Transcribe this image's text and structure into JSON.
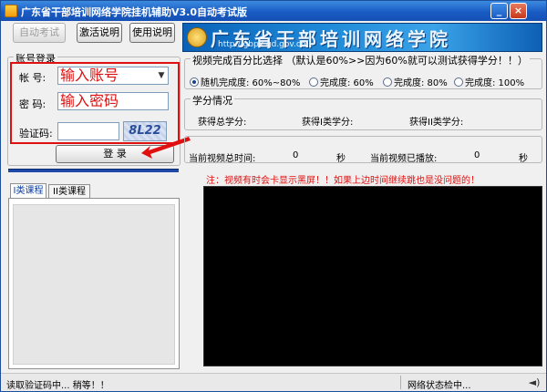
{
  "window": {
    "title": "广东省干部培训网络学院挂机辅助V3.0自动考试版",
    "minimize_glyph": "_",
    "close_glyph": "×"
  },
  "toolbar": {
    "auto_exam": "自动考试",
    "activate_help": "激活说明",
    "usage_help": "使用说明"
  },
  "banner": {
    "title": "广东省干部培训网络学院",
    "url": "http://gbpx.gd.gov.cn"
  },
  "login": {
    "group_title": "账号登录",
    "account_label": "帐  号:",
    "account_value": "输入账号",
    "password_label": "密  码:",
    "password_value": "输入密码",
    "captcha_label": "验证码:",
    "captcha_value": "",
    "captcha_image_text": "8L22",
    "login_button": "登 录"
  },
  "progress": {
    "group_title": "视频完成百分比选择 （默认是60%>>因为60%就可以测试获得学分！！）",
    "options": [
      {
        "label": "随机完成度: 60%~80%",
        "selected": true
      },
      {
        "label": "完成度: 60%",
        "selected": false
      },
      {
        "label": "完成度: 80%",
        "selected": false
      },
      {
        "label": "完成度: 100%",
        "selected": false
      }
    ]
  },
  "study": {
    "group_title": "学分情况",
    "total_credit_label": "获得总学分:",
    "class1_credit_label": "获得I类学分:",
    "class2_credit_label": "获得II类学分:"
  },
  "video_stats": {
    "total_time_label": "当前视频总时间:",
    "total_time_value": "0",
    "unit": "秒",
    "played_label": "当前视频已播放:",
    "played_value": "0"
  },
  "tabs": [
    {
      "label": "I类课程",
      "active": true
    },
    {
      "label": "II类课程",
      "active": false
    }
  ],
  "notice": "注：视频有时会卡显示黑屏！！如果上边时间继续跳也是没问题的！",
  "status": {
    "left": "读取验证码中...    稍等！！",
    "right": "网络状态检中..."
  },
  "colors": {
    "titlebar": "#1a5cc4",
    "highlight_red": "#e01010",
    "video_bg": "#000000"
  }
}
